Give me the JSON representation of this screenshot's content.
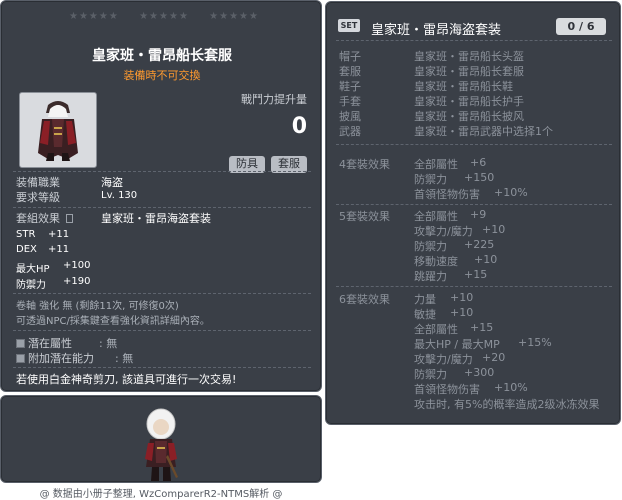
{
  "item_id": "01052808",
  "stars": [
    "★★★★★",
    "★★★★★",
    "★★★★★"
  ],
  "item": {
    "name": "皇家班・雷昂船长套服",
    "trade_note": "装備時不可交換",
    "power_label": "戰鬥力提升量",
    "power_value": "0",
    "tags": [
      "防具",
      "套服"
    ],
    "job_label": "装備職業",
    "job_value": "海盗",
    "level_label": "要求等級",
    "level_value": "Lv. 130",
    "set_label": "套組效果",
    "set_value": "皇家班・雷昂海盗套装",
    "stats": [
      {
        "name": "STR",
        "value": "+11"
      },
      {
        "name": "DEX",
        "value": "+11"
      },
      {
        "name": "最大HP",
        "value": "+100"
      },
      {
        "name": "防禦力",
        "value": "+190"
      }
    ],
    "scroll_line": "卷軸 強化 無 (剩餘11次, 可修復0次)",
    "npc_line": "可透過NPC/採集鍵查看強化資訊詳細內容。",
    "potential_label": "潛在屬性",
    "potential_value": ": 無",
    "add_potential_label": "附加潛在能力",
    "add_potential_value": ": 無",
    "scissors_line": "若使用白金神奇剪刀, 該道具可進行一次交易!"
  },
  "footer": "@ 数据由小册子整理, WzComparerR2-NTMS解析 @",
  "set": {
    "badge": "SET",
    "title": "皇家班・雷昂海盗套装",
    "count": "0 / 6",
    "pieces": [
      {
        "slot": "帽子",
        "name": "皇家班・雷昂船长头盔"
      },
      {
        "slot": "套服",
        "name": "皇家班・雷昂船长套服"
      },
      {
        "slot": "鞋子",
        "name": "皇家班・雷昂船长鞋"
      },
      {
        "slot": "手套",
        "name": "皇家班・雷昂船长护手"
      },
      {
        "slot": "披風",
        "name": "皇家班・雷昂船长披风"
      },
      {
        "slot": "武器",
        "name": "皇家班・雷昂武器中选择1个"
      }
    ],
    "effects": [
      {
        "title": "4套裝效果",
        "lines": [
          {
            "name": "全部屬性",
            "value": "+6"
          },
          {
            "name": "防禦力",
            "value": "+150"
          },
          {
            "name": "首領怪物伤害",
            "value": "+10%"
          }
        ]
      },
      {
        "title": "5套裝效果",
        "lines": [
          {
            "name": "全部屬性",
            "value": "+9"
          },
          {
            "name": "攻擊力/魔力",
            "value": "+10"
          },
          {
            "name": "防禦力",
            "value": "+225"
          },
          {
            "name": "移動速度",
            "value": "+10"
          },
          {
            "name": "跳躍力",
            "value": "+15"
          }
        ]
      },
      {
        "title": "6套裝效果",
        "lines": [
          {
            "name": "力量",
            "value": "+10"
          },
          {
            "name": "敏捷",
            "value": "+10"
          },
          {
            "name": "全部屬性",
            "value": "+15"
          },
          {
            "name": "最大HP / 最大MP",
            "value": "+15%"
          },
          {
            "name": "攻擊力/魔力",
            "value": "+20"
          },
          {
            "name": "防禦力",
            "value": "+300"
          },
          {
            "name": "首領怪物伤害",
            "value": "+10%"
          },
          {
            "name": "攻击时, 有5%的概率造成2级冰冻效果",
            "value": ""
          }
        ]
      }
    ]
  }
}
